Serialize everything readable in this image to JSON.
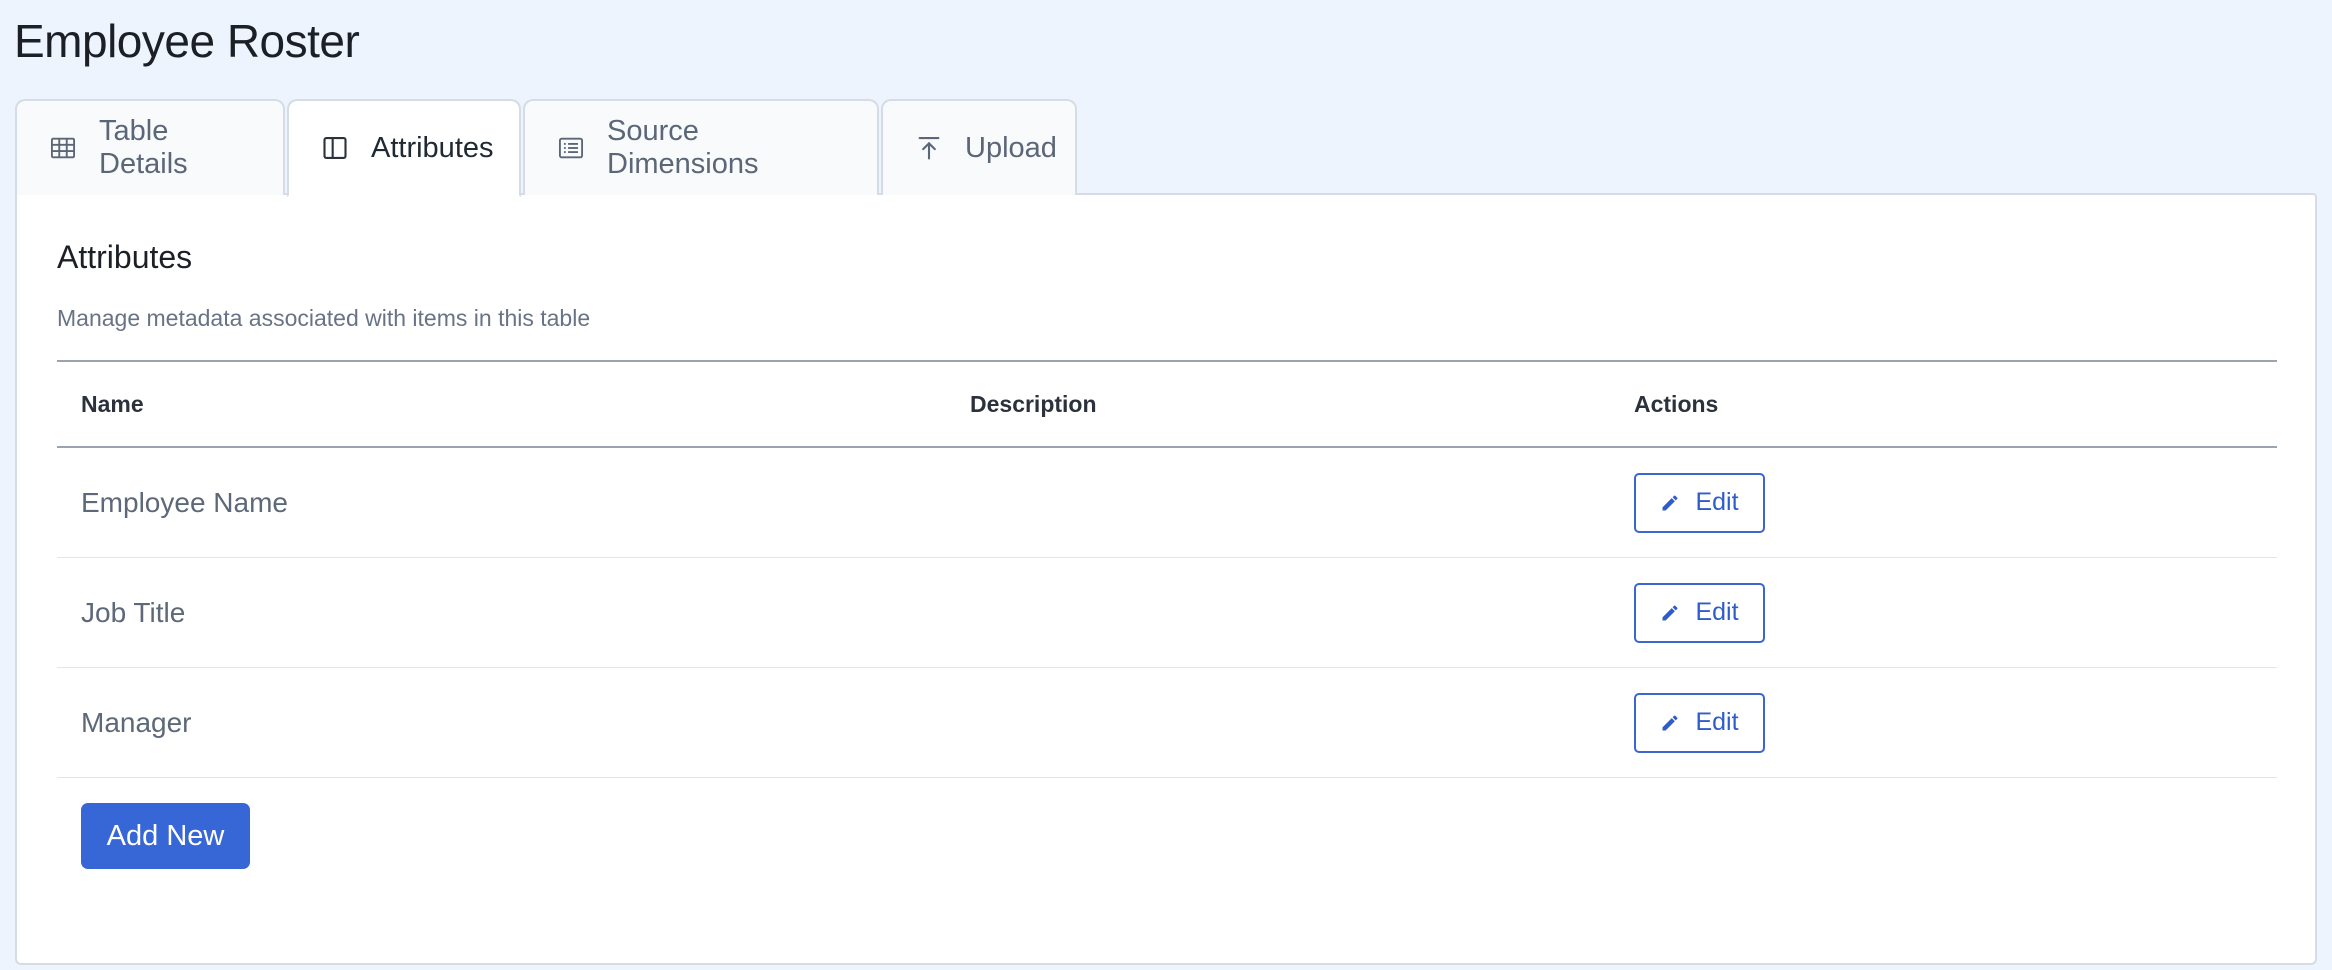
{
  "page": {
    "title": "Employee Roster"
  },
  "tabs": [
    {
      "label": "Table Details",
      "icon": "table-grid-icon",
      "active": false
    },
    {
      "label": "Attributes",
      "icon": "columns-icon",
      "active": true
    },
    {
      "label": "Source Dimensions",
      "icon": "list-icon",
      "active": false
    },
    {
      "label": "Upload",
      "icon": "upload-icon",
      "active": false
    }
  ],
  "attributes": {
    "title": "Attributes",
    "subtitle": "Manage metadata associated with items in this table",
    "columns": {
      "name": "Name",
      "description": "Description",
      "actions": "Actions"
    },
    "rows": [
      {
        "name": "Employee Name",
        "description": "",
        "action_label": "Edit"
      },
      {
        "name": "Job Title",
        "description": "",
        "action_label": "Edit"
      },
      {
        "name": "Manager",
        "description": "",
        "action_label": "Edit"
      }
    ],
    "add_label": "Add New"
  },
  "colors": {
    "background": "#edf4fd",
    "accent": "#3766d6",
    "border": "#d5dce5"
  }
}
